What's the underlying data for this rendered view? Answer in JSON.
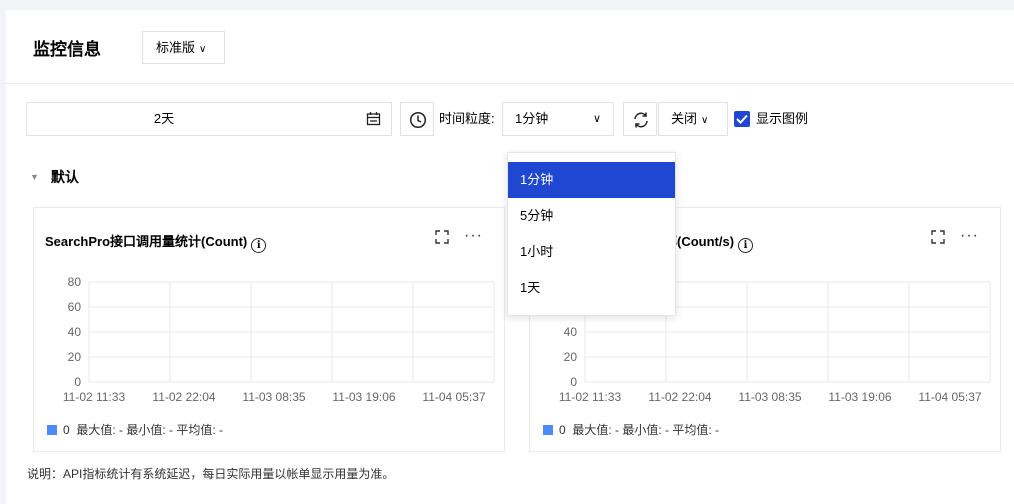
{
  "header": {
    "title": "监控信息",
    "edition": "标准版"
  },
  "toolbar": {
    "date_value": "2天",
    "granularity_label": "时间粒度:",
    "granularity_value": "1分钟",
    "auto_refresh_value": "关闭",
    "show_legend_label": "显示图例",
    "show_legend_checked": true
  },
  "section": {
    "title": "默认"
  },
  "cards": [
    {
      "title": "SearchPro接口调用量统计(Count)",
      "legend": {
        "value": "0",
        "text": "最大值: - 最小值: - 平均值: -"
      },
      "chart_data": {
        "type": "line",
        "x": [
          "11-02 11:33",
          "11-02 22:04",
          "11-03 08:35",
          "11-03 19:06",
          "11-04 05:37"
        ],
        "yticks": [
          "80",
          "60",
          "40",
          "20",
          "0"
        ],
        "series": []
      }
    },
    {
      "title_visible_fragment": "率(Count/s)",
      "legend": {
        "value": "0",
        "text": "最大值: - 最小值: - 平均值: -"
      },
      "chart_data": {
        "type": "line",
        "x": [
          "11-02 11:33",
          "11-02 22:04",
          "11-03 08:35",
          "11-03 19:06",
          "11-04 05:37"
        ],
        "yticks": [
          "60",
          "40",
          "20",
          "0"
        ],
        "partial_ytick": "60",
        "series": []
      }
    }
  ],
  "dropdown": {
    "items": [
      "1分钟",
      "5分钟",
      "1小时",
      "1天"
    ],
    "selected": "1分钟"
  },
  "note": "说明：API指标统计有系统延迟，每日实际用量以帐单显示用量为准。",
  "colors": {
    "accent": "#1f47d1",
    "legend_swatch": "#4b8ef3",
    "grid": "#e6e8ec"
  }
}
